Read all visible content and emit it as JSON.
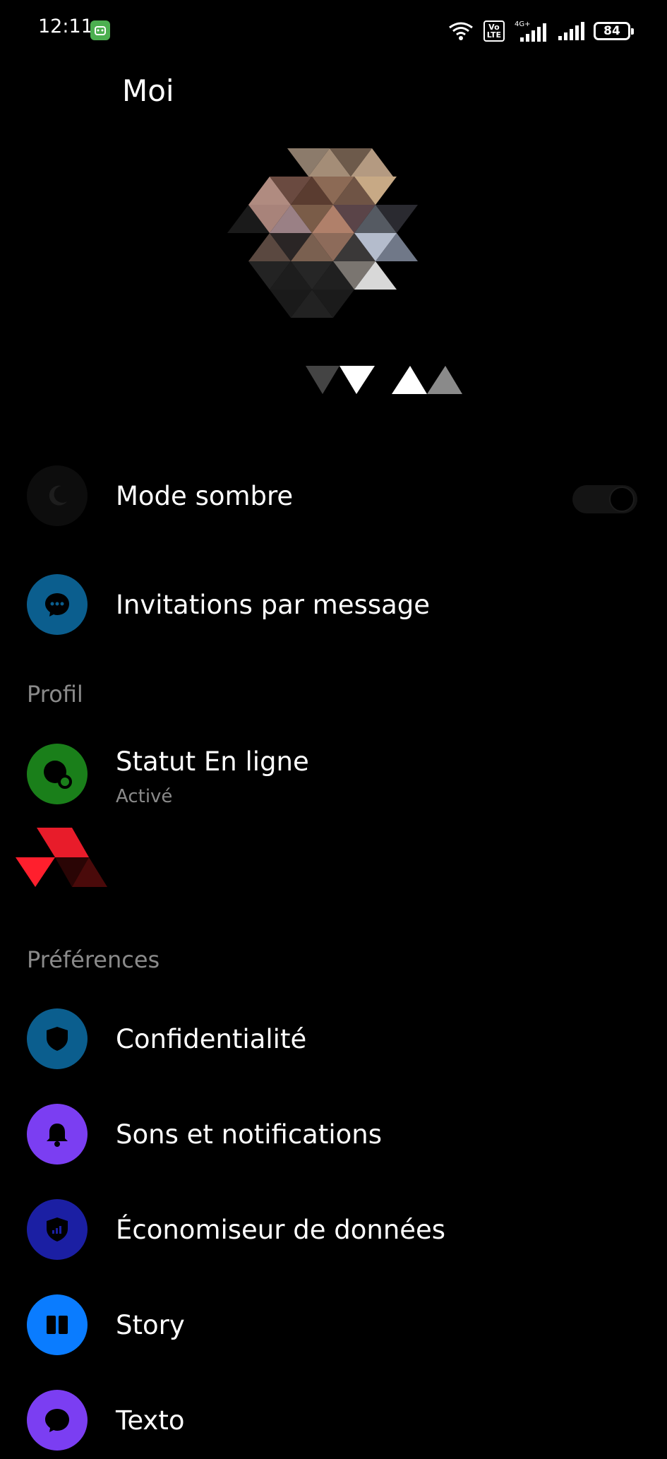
{
  "status_bar": {
    "time": "12:11",
    "volte": "Vo\nLTE",
    "network": "4G+",
    "battery": "84"
  },
  "header": {
    "title": "Moi"
  },
  "rows": {
    "dark_mode": {
      "label": "Mode sombre",
      "icon": "moon-icon",
      "toggle_on": true
    },
    "message_invites": {
      "label": "Invitations par message",
      "icon": "chat-bubble-icon"
    }
  },
  "sections": {
    "profile": {
      "title": "Profil",
      "online_status": {
        "label": "Statut En ligne",
        "value": "Activé",
        "icon": "online-status-icon"
      }
    },
    "preferences": {
      "title": "Préférences",
      "items": [
        {
          "label": "Confidentialité",
          "icon": "shield-icon",
          "color": "#0b5e8e"
        },
        {
          "label": "Sons et notifications",
          "icon": "bell-icon",
          "color": "#7b3ef2"
        },
        {
          "label": "Économiseur de données",
          "icon": "data-shield-icon",
          "color": "#1b1fa3"
        },
        {
          "label": "Story",
          "icon": "story-icon",
          "color": "#0a7cff"
        },
        {
          "label": "Texto",
          "icon": "sms-bubble-icon",
          "color": "#7b3ef2"
        }
      ]
    }
  },
  "colors": {
    "background": "#000000",
    "muted_text": "#8a8a8a",
    "messages_blue": "#0b5e8e",
    "online_green": "#1a7f1a"
  }
}
